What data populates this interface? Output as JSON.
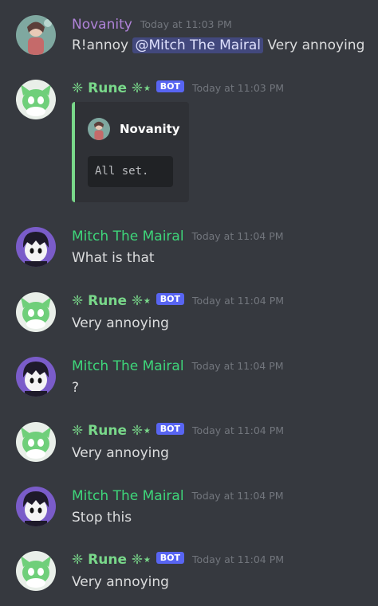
{
  "users": {
    "novanity": "Novanity",
    "rune": "❈ Rune ❈⋆",
    "mitch": "Mitch The Mairal"
  },
  "bot_tag": "BOT",
  "messages": [
    {
      "author": "Novanity",
      "timestamp": "Today at 11:03 PM",
      "prefix": "R!annoy ",
      "mention": "@Mitch The Mairal",
      "suffix": " Very annoying"
    },
    {
      "author": "❈ Rune ❈⋆",
      "timestamp": "Today at 11:03 PM",
      "embed": {
        "author": "Novanity",
        "code": "All set."
      }
    },
    {
      "author": "Mitch The Mairal",
      "timestamp": "Today at 11:04 PM",
      "text": "What is that"
    },
    {
      "author": "❈ Rune ❈⋆",
      "timestamp": "Today at 11:04 PM",
      "text": "Very annoying"
    },
    {
      "author": "Mitch The Mairal",
      "timestamp": "Today at 11:04 PM",
      "text": "?"
    },
    {
      "author": "❈ Rune ❈⋆",
      "timestamp": "Today at 11:04 PM",
      "text": "Very annoying"
    },
    {
      "author": "Mitch The Mairal",
      "timestamp": "Today at 11:04 PM",
      "text": "Stop this"
    },
    {
      "author": "❈ Rune ❈⋆",
      "timestamp": "Today at 11:04 PM",
      "text": "Very annoying"
    }
  ],
  "colors": {
    "background": "#36393f",
    "novanity": "#b083d9",
    "rune": "#79d88a",
    "mitch": "#3ed67a",
    "bot_tag": "#5865f2",
    "mention_bg": "#4c5595"
  },
  "icons": {
    "novanity_avatar": "novanity-avatar-icon",
    "rune_avatar": "rune-green-creature-avatar-icon",
    "mitch_avatar": "mitch-dark-hair-avatar-icon"
  }
}
